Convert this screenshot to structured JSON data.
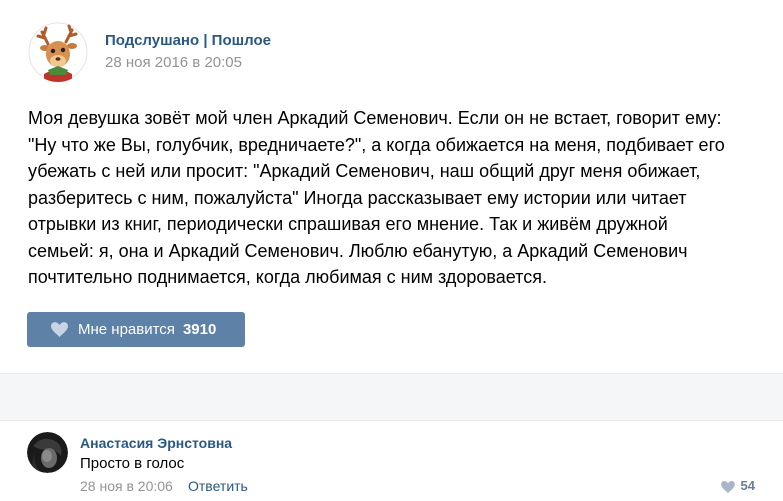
{
  "post": {
    "author": "Подслушано | Пошлое",
    "date": "28 ноя 2016 в 20:05",
    "avatar_icon": "deer-avatar",
    "text_lines": [
      "Моя девушка зовёт мой член Аркадий Семенович. Если он не встает, говорит ему:",
      "\"Ну что же Вы, голубчик, вредничаете?\", а когда обижается на меня, подбивает его",
      "убежать с ней или просит: \"Аркадий Семенович, наш общий друг меня обижает,",
      "разберитесь с ним, пожалуйста\" Иногда рассказывает ему истории или читает",
      "отрывки из книг, периодически спрашивая его мнение. Так и живём дружной",
      "семьей: я, она и Аркадий Семенович. Люблю ебанутую, а Аркадий Семенович",
      "почтительно поднимается, когда любимая с ним здоровается."
    ],
    "like": {
      "label": "Мне нравится",
      "count": "3910",
      "icon": "heart-icon"
    }
  },
  "comment": {
    "author": "Анастасия Эрнстовна",
    "text": "Просто в голос",
    "date": "28 ноя в 20:06",
    "reply_label": "Ответить",
    "like_count": "54",
    "avatar_icon": "user-avatar"
  },
  "colors": {
    "link": "#2a5885",
    "muted": "#939393",
    "like_button": "#5e81a8",
    "band": "#f5f6f8"
  }
}
